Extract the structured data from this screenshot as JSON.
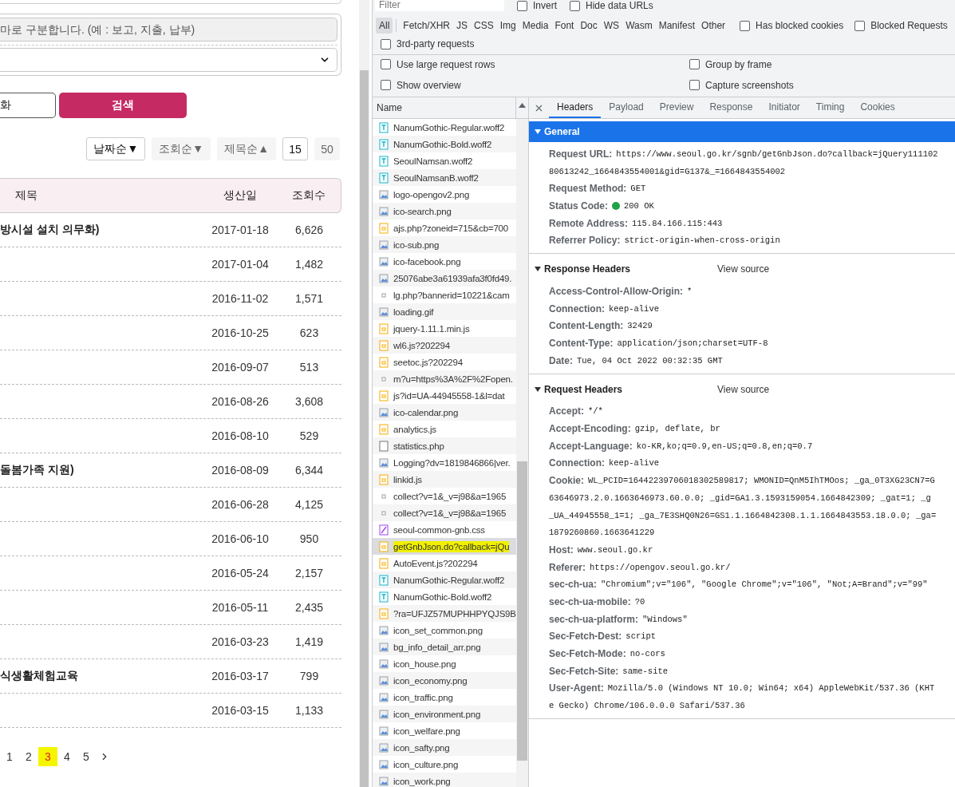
{
  "search_form": {
    "keyword_field": {
      "placeholder": "마로 구분합니다. (예 : 보고, 지출, 납부)"
    },
    "buttons": [
      {
        "label": "화",
        "kind": "reset"
      },
      {
        "label": "검색",
        "kind": "search"
      }
    ],
    "sort_options": [
      {
        "label": "날짜순▼",
        "selected": true
      },
      {
        "label": "조회순▼",
        "selected": false
      },
      {
        "label": "제목순▲",
        "selected": false
      }
    ],
    "page_sizes": [
      {
        "label": "15",
        "selected": true
      },
      {
        "label": "50",
        "selected": false
      }
    ]
  },
  "table": {
    "columns": [
      "제목",
      "생산일",
      "조회수"
    ],
    "rows": [
      {
        "title": "방시설 설치 의무화)",
        "date": "2017-01-18",
        "views": "6,626"
      },
      {
        "date": "2017-01-04",
        "views": "1,482"
      },
      {
        "date": "2016-11-02",
        "views": "1,571"
      },
      {
        "date": "2016-10-25",
        "views": "623"
      },
      {
        "date": "2016-09-07",
        "views": "513"
      },
      {
        "date": "2016-08-26",
        "views": "3,608"
      },
      {
        "date": "2016-08-10",
        "views": "529"
      },
      {
        "title": "돌봄가족 지원)",
        "date": "2016-08-09",
        "views": "6,344"
      },
      {
        "date": "2016-06-28",
        "views": "4,125"
      },
      {
        "date": "2016-06-10",
        "views": "950"
      },
      {
        "date": "2016-05-24",
        "views": "2,157"
      },
      {
        "date": "2016-05-11",
        "views": "2,435"
      },
      {
        "date": "2016-03-23",
        "views": "1,419"
      },
      {
        "title": "식생활체험교육",
        "date": "2016-03-17",
        "views": "799"
      },
      {
        "date": "2016-03-15",
        "views": "1,133"
      }
    ]
  },
  "pagination": {
    "pages": [
      {
        "label": "1",
        "selected": false,
        "highlighted": false
      },
      {
        "label": "2",
        "selected": false,
        "highlighted": false
      },
      {
        "label": "3",
        "selected": true,
        "highlighted": true
      },
      {
        "label": "4",
        "selected": false,
        "highlighted": false
      },
      {
        "label": "5",
        "selected": false,
        "highlighted": false
      }
    ]
  },
  "devtools": {
    "filter": {
      "placeholder": "Filter"
    },
    "filter_options": [
      {
        "label": "Invert",
        "checked": false
      },
      {
        "label": "Hide data URLs",
        "checked": false
      }
    ],
    "type_filters": [
      {
        "label": "All",
        "selected": true
      },
      {
        "label": "Fetch/XHR",
        "selected": false
      },
      {
        "label": "JS",
        "selected": false
      },
      {
        "label": "CSS",
        "selected": false
      },
      {
        "label": "Img",
        "selected": false
      },
      {
        "label": "Media",
        "selected": false
      },
      {
        "label": "Font",
        "selected": false
      },
      {
        "label": "Doc",
        "selected": false
      },
      {
        "label": "WS",
        "selected": false
      },
      {
        "label": "Wasm",
        "selected": false
      },
      {
        "label": "Manifest",
        "selected": false
      },
      {
        "label": "Other",
        "selected": false
      }
    ],
    "request_filters": [
      {
        "label": "Has blocked cookies",
        "checked": false
      },
      {
        "label": "Blocked Requests",
        "checked": false
      },
      {
        "label": "3rd-party requests",
        "checked": false
      }
    ],
    "settings": [
      {
        "label": "Use large request rows",
        "checked": false
      },
      {
        "label": "Group by frame",
        "checked": false
      },
      {
        "label": "Show overview",
        "checked": false
      },
      {
        "label": "Capture screenshots",
        "checked": false
      }
    ],
    "request_list": {
      "column": "Name",
      "requests": [
        {
          "name": "NanumGothic-Regular.woff2",
          "kind": "font",
          "selected": false,
          "highlighted": false
        },
        {
          "name": "NanumGothic-Bold.woff2",
          "kind": "font",
          "selected": false,
          "highlighted": false
        },
        {
          "name": "SeoulNamsan.woff2",
          "kind": "font",
          "selected": false,
          "highlighted": false
        },
        {
          "name": "SeoulNamsanB.woff2",
          "kind": "font",
          "selected": false,
          "highlighted": false
        },
        {
          "name": "logo-opengov2.png",
          "kind": "image",
          "selected": false,
          "highlighted": false
        },
        {
          "name": "ico-search.png",
          "kind": "image",
          "selected": false,
          "highlighted": false
        },
        {
          "name": "ajs.php?zoneid=715&cb=700",
          "kind": "script",
          "selected": false,
          "highlighted": false
        },
        {
          "name": "ico-sub.png",
          "kind": "image",
          "selected": false,
          "highlighted": false
        },
        {
          "name": "ico-facebook.png",
          "kind": "image",
          "selected": false,
          "highlighted": false
        },
        {
          "name": "25076abe3a61939afa3f0fd49.",
          "kind": "image",
          "selected": false,
          "highlighted": false
        },
        {
          "name": "lg.php?bannerid=10221&cam",
          "kind": "other",
          "selected": false,
          "highlighted": false
        },
        {
          "name": "loading.gif",
          "kind": "image",
          "selected": false,
          "highlighted": false
        },
        {
          "name": "jquery-1.11.1.min.js",
          "kind": "script",
          "selected": false,
          "highlighted": false
        },
        {
          "name": "wl6.js?202294",
          "kind": "script",
          "selected": false,
          "highlighted": false
        },
        {
          "name": "seetoc.js?202294",
          "kind": "script",
          "selected": false,
          "highlighted": false
        },
        {
          "name": "m?u=https%3A%2F%2Fopen.",
          "kind": "other",
          "selected": false,
          "highlighted": false
        },
        {
          "name": "js?id=UA-44945558-1&l=dat",
          "kind": "script",
          "selected": false,
          "highlighted": false
        },
        {
          "name": "ico-calendar.png",
          "kind": "image",
          "selected": false,
          "highlighted": false
        },
        {
          "name": "analytics.js",
          "kind": "script",
          "selected": false,
          "highlighted": false
        },
        {
          "name": "statistics.php",
          "kind": "doc",
          "selected": false,
          "highlighted": false
        },
        {
          "name": "Logging?dv=1819846866|ver.",
          "kind": "image",
          "selected": false,
          "highlighted": false
        },
        {
          "name": "linkid.js",
          "kind": "script",
          "selected": false,
          "highlighted": false
        },
        {
          "name": "collect?v=1&_v=j98&a=1965",
          "kind": "other",
          "selected": false,
          "highlighted": false
        },
        {
          "name": "collect?v=1&_v=j98&a=1965",
          "kind": "other",
          "selected": false,
          "highlighted": false
        },
        {
          "name": "seoul-common-gnb.css",
          "kind": "css",
          "selected": false,
          "highlighted": false
        },
        {
          "name": "getGnbJson.do?callback=jQu",
          "kind": "script",
          "selected": true,
          "highlighted": true
        },
        {
          "name": "AutoEvent.js?202294",
          "kind": "script",
          "selected": false,
          "highlighted": false
        },
        {
          "name": "NanumGothic-Regular.woff2",
          "kind": "font",
          "selected": false,
          "highlighted": false
        },
        {
          "name": "NanumGothic-Bold.woff2",
          "kind": "font",
          "selected": false,
          "highlighted": false
        },
        {
          "name": "?ra=UFJZ57MUPHHPYQJS9B",
          "kind": "script",
          "selected": false,
          "highlighted": false
        },
        {
          "name": "icon_set_common.png",
          "kind": "image",
          "selected": false,
          "highlighted": false
        },
        {
          "name": "bg_info_detail_arr.png",
          "kind": "image",
          "selected": false,
          "highlighted": false
        },
        {
          "name": "icon_house.png",
          "kind": "image",
          "selected": false,
          "highlighted": false
        },
        {
          "name": "icon_economy.png",
          "kind": "image",
          "selected": false,
          "highlighted": false
        },
        {
          "name": "icon_traffic.png",
          "kind": "image",
          "selected": false,
          "highlighted": false
        },
        {
          "name": "icon_environment.png",
          "kind": "image",
          "selected": false,
          "highlighted": false
        },
        {
          "name": "icon_welfare.png",
          "kind": "image",
          "selected": false,
          "highlighted": false
        },
        {
          "name": "icon_safty.png",
          "kind": "image",
          "selected": false,
          "highlighted": false
        },
        {
          "name": "icon_culture.png",
          "kind": "image",
          "selected": false,
          "highlighted": false
        },
        {
          "name": "icon_work.png",
          "kind": "image",
          "selected": false,
          "highlighted": false
        }
      ]
    },
    "detail_tabs": [
      {
        "label": "Headers",
        "selected": true
      },
      {
        "label": "Payload",
        "selected": false
      },
      {
        "label": "Preview",
        "selected": false
      },
      {
        "label": "Response",
        "selected": false
      },
      {
        "label": "Initiator",
        "selected": false
      },
      {
        "label": "Timing",
        "selected": false
      },
      {
        "label": "Cookies",
        "selected": false
      }
    ],
    "sections": [
      {
        "title": "General",
        "expanded": true,
        "selected": true,
        "rows": [
          {
            "name": "Request URL:",
            "lines": [
              "https://www.seoul.go.kr/sgnb/getGnbJson.do?callback=jQuery111102",
              "80613242_1664843554001&gid=G137&_=1664843554002"
            ]
          },
          {
            "name": "Request Method:",
            "lines": [
              "GET"
            ]
          },
          {
            "name": "Status Code:",
            "lines": [
              "200 OK"
            ],
            "color": "#1ea446"
          },
          {
            "name": "Remote Address:",
            "lines": [
              "115.84.166.115:443"
            ]
          },
          {
            "name": "Referrer Policy:",
            "lines": [
              "strict-origin-when-cross-origin"
            ]
          }
        ]
      },
      {
        "title": "Response Headers",
        "expanded": true,
        "selected": false,
        "view_source": "View source",
        "rows": [
          {
            "name": "Access-Control-Allow-Origin:",
            "lines": [
              "*"
            ]
          },
          {
            "name": "Connection:",
            "lines": [
              "keep-alive"
            ]
          },
          {
            "name": "Content-Length:",
            "lines": [
              "32429"
            ]
          },
          {
            "name": "Content-Type:",
            "lines": [
              "application/json;charset=UTF-8"
            ]
          },
          {
            "name": "Date:",
            "lines": [
              "Tue, 04 Oct 2022 00:32:35 GMT"
            ]
          }
        ]
      },
      {
        "title": "Request Headers",
        "expanded": true,
        "selected": false,
        "view_source": "View source",
        "rows": [
          {
            "name": "Accept:",
            "lines": [
              "*/*"
            ]
          },
          {
            "name": "Accept-Encoding:",
            "lines": [
              "gzip, deflate, br"
            ]
          },
          {
            "name": "Accept-Language:",
            "lines": [
              "ko-KR,ko;q=0.9,en-US;q=0.8,en;q=0.7"
            ]
          },
          {
            "name": "Connection:",
            "lines": [
              "keep-alive"
            ]
          },
          {
            "name": "Cookie:",
            "lines": [
              "WL_PCID=16442239706018302589817; WMONID=QnM5IhTMOos; _ga_0T3XG23CN7=G",
              "63646973.2.0.1663646973.60.0.0; _gid=GA1.3.1593159054.1664842309; _gat=1; _g",
              "_UA_44945558_1=1; _ga_7E3SHQ0N26=GS1.1.1664842308.1.1.1664843553.18.0.0; _ga=",
              "1879260860.1663641229"
            ]
          },
          {
            "name": "Host:",
            "lines": [
              "www.seoul.go.kr"
            ]
          },
          {
            "name": "Referer:",
            "lines": [
              "https://opengov.seoul.go.kr/"
            ]
          },
          {
            "name": "sec-ch-ua:",
            "lines": [
              "\"Chromium\";v=\"106\", \"Google Chrome\";v=\"106\", \"Not;A=Brand\";v=\"99\""
            ]
          },
          {
            "name": "sec-ch-ua-mobile:",
            "lines": [
              "?0"
            ]
          },
          {
            "name": "sec-ch-ua-platform:",
            "lines": [
              "\"Windows\""
            ]
          },
          {
            "name": "Sec-Fetch-Dest:",
            "lines": [
              "script"
            ]
          },
          {
            "name": "Sec-Fetch-Mode:",
            "lines": [
              "no-cors"
            ]
          },
          {
            "name": "Sec-Fetch-Site:",
            "lines": [
              "same-site"
            ]
          },
          {
            "name": "User-Agent:",
            "lines": [
              "Mozilla/5.0 (Windows NT 10.0; Win64; x64) AppleWebKit/537.36 (KHT",
              "e Gecko) Chrome/106.0.0.0 Safari/537.36"
            ]
          }
        ]
      }
    ]
  }
}
